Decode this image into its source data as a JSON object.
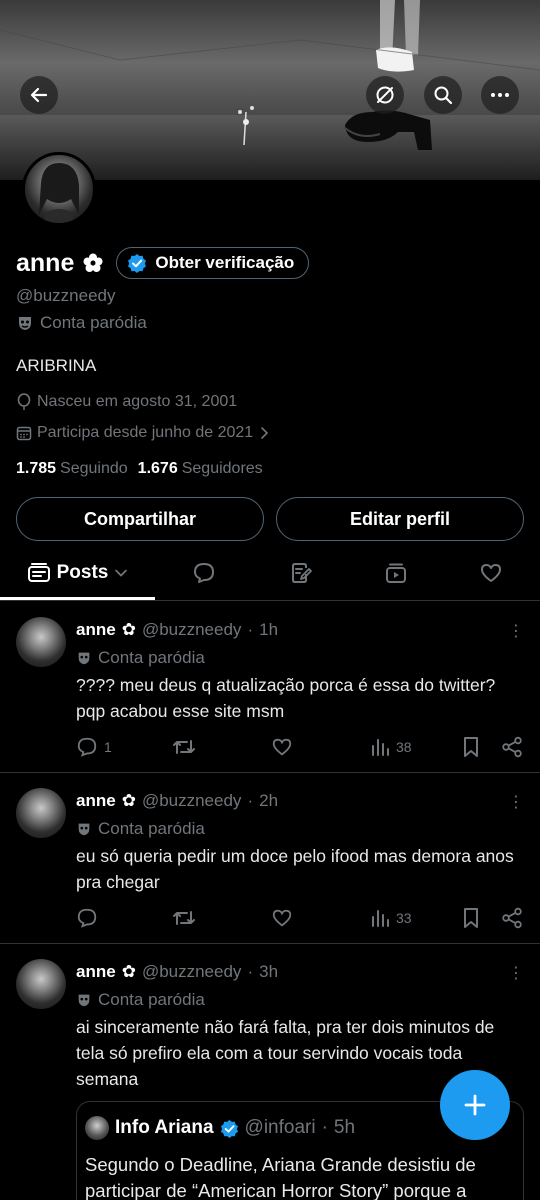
{
  "profile": {
    "name": "anne",
    "verification_label": "Obter verificação",
    "handle": "@buzzneedy",
    "parody_label": "Conta paródia",
    "bio": "ARIBRINA",
    "birth": "Nasceu em agosto 31, 2001",
    "joined": "Participa desde junho de 2021",
    "following_count": "1.785",
    "following_label": "Seguindo",
    "followers_count": "1.676",
    "followers_label": "Seguidores"
  },
  "buttons": {
    "share": "Compartilhar",
    "edit": "Editar perfil"
  },
  "tabs": {
    "posts_label": "Posts",
    "icons": [
      "feed-icon",
      "reply-bubble-icon",
      "article-icon",
      "media-icon",
      "heart-icon"
    ]
  },
  "posts": [
    {
      "name": "anne",
      "handle": "@buzzneedy",
      "time": "1h",
      "parody": "Conta paródia",
      "text": "???? meu deus q atualização porca é essa do twitter? pqp acabou esse site msm",
      "replies": "1",
      "retweets": "",
      "likes": "",
      "views": "38"
    },
    {
      "name": "anne",
      "handle": "@buzzneedy",
      "time": "2h",
      "parody": "Conta paródia",
      "text": "eu só queria pedir um doce pelo ifood mas demora anos pra chegar",
      "replies": "",
      "retweets": "",
      "likes": "",
      "views": "33"
    },
    {
      "name": "anne",
      "handle": "@buzzneedy",
      "time": "3h",
      "parody": "Conta paródia",
      "text": "ai sinceramente não fará falta, pra ter dois minutos de tela só prefiro ela com a tour servindo vocais toda semana",
      "quote": {
        "name": "Info Ariana",
        "handle": "@infoari",
        "time": "5h",
        "text": "Segundo o Deadline, Ariana Grande desistiu de participar de “American Horror Story” porque a"
      }
    }
  ],
  "colors": {
    "accent": "#1d9bf0",
    "background": "#000000",
    "muted": "#71767b",
    "border": "#2f3336"
  }
}
